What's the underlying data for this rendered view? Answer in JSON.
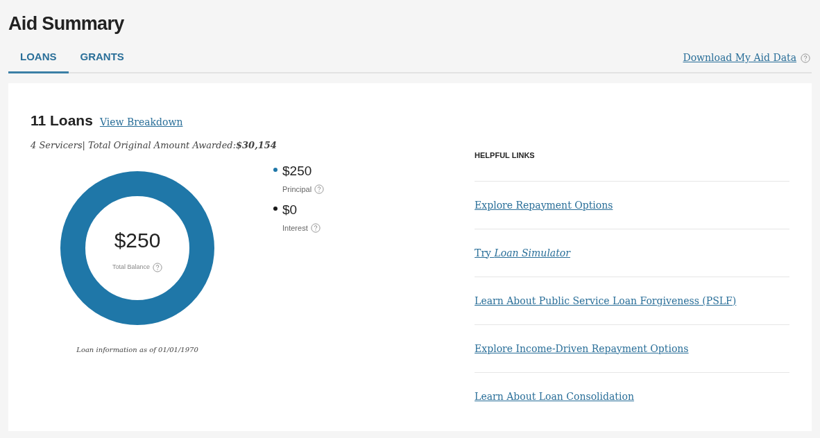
{
  "title": "Aid Summary",
  "tabs": [
    {
      "label": "LOANS",
      "selected": true
    },
    {
      "label": "GRANTS",
      "selected": false
    }
  ],
  "download_link": "Download My Aid Data",
  "summary": {
    "heading": "11 Loans",
    "breakdown_link": "View Breakdown",
    "subtitle": "4 Servicers| Total Original Amount Awarded:**$30,154**",
    "total": "$250",
    "total_label": "Total Balance",
    "legend": [
      {
        "amount": "$250",
        "label": "Principal",
        "color": "#1f77a8"
      },
      {
        "amount": "$0",
        "label": "Interest",
        "color": "#1a1a1a"
      }
    ],
    "as_of": "Loan information as of 01/01/1970"
  },
  "helpful_links": {
    "heading": "HELPFUL LINKS",
    "links": [
      "Explore Repayment Options",
      "Try *Loan Simulator*",
      "Learn About Public Service Loan Forgiveness (PSLF)",
      "Explore Income-Driven Repayment Options",
      "Learn About Loan Consolidation"
    ]
  }
}
